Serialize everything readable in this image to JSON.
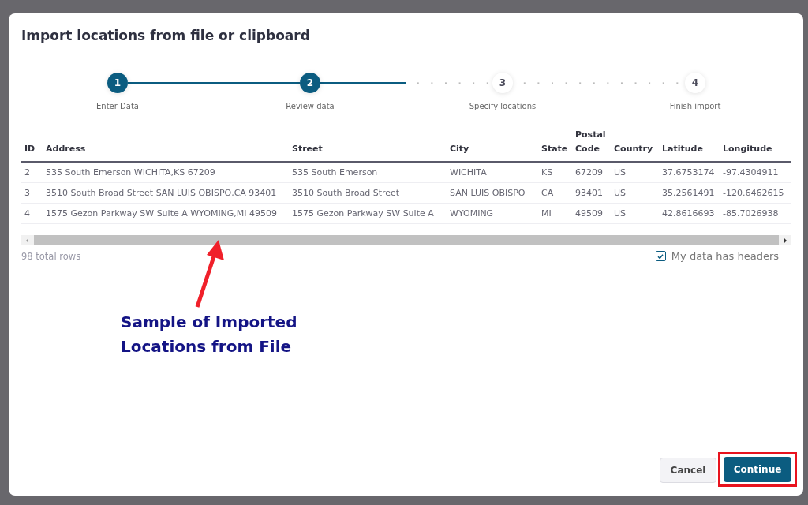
{
  "dialog": {
    "title": "Import locations from file or clipboard"
  },
  "steps": [
    {
      "number": "1",
      "label": "Enter Data",
      "completed": true
    },
    {
      "number": "2",
      "label": "Review data",
      "completed": true
    },
    {
      "number": "3",
      "label": "Specify locations",
      "completed": false
    },
    {
      "number": "4",
      "label": "Finish import",
      "completed": false
    }
  ],
  "table": {
    "columns": [
      "ID",
      "Address",
      "Street",
      "City",
      "State",
      "Postal Code",
      "Country",
      "Latitude",
      "Longitude"
    ],
    "rows": [
      [
        "2",
        "535 South Emerson WICHITA,KS 67209",
        "535 South Emerson",
        "WICHITA",
        "KS",
        "67209",
        "US",
        "37.6753174",
        "-97.4304911"
      ],
      [
        "3",
        "3510 South Broad Street SAN LUIS OBISPO,CA 93401",
        "3510 South Broad Street",
        "SAN LUIS OBISPO",
        "CA",
        "93401",
        "US",
        "35.2561491",
        "-120.6462615"
      ],
      [
        "4",
        "1575 Gezon Parkway SW Suite A WYOMING,MI 49509",
        "1575 Gezon Parkway SW Suite A",
        "WYOMING",
        "MI",
        "49509",
        "US",
        "42.8616693",
        "-85.7026938"
      ]
    ]
  },
  "total_rows": "98 total rows",
  "headers_checkbox": {
    "label": "My data has headers",
    "checked": true
  },
  "annotation": {
    "text": "Sample of Imported Locations from File"
  },
  "buttons": {
    "cancel": "Cancel",
    "continue": "Continue",
    "continue_highlighted": true
  }
}
